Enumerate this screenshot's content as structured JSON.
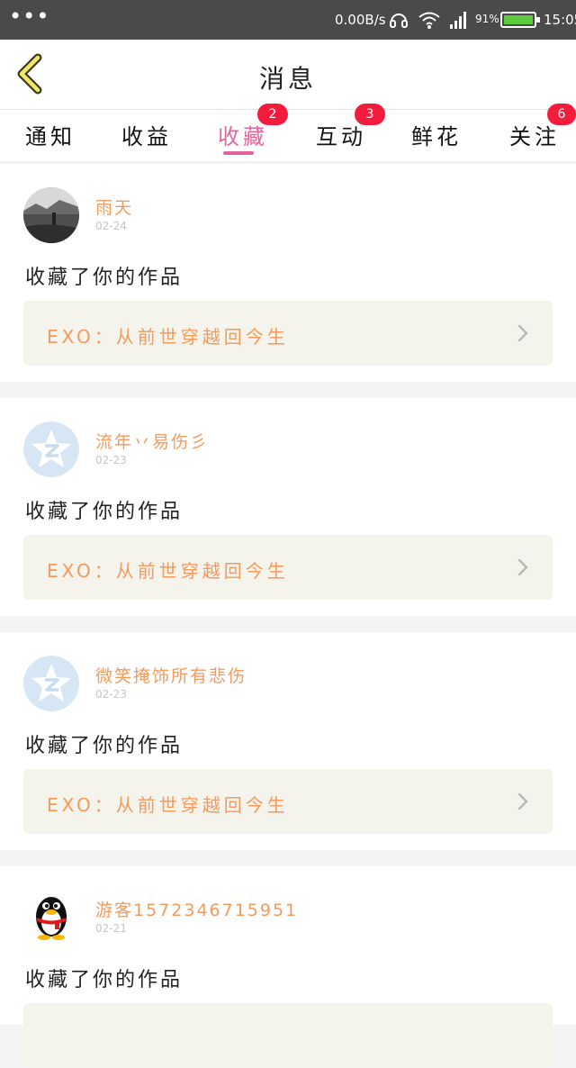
{
  "status_bar": {
    "dots": "•••",
    "network_speed": "0.00B/s",
    "battery_percent": "91%",
    "time": "15:05",
    "icons": [
      "headphones-icon",
      "wifi-icon",
      "signal-icon",
      "battery-icon"
    ]
  },
  "nav": {
    "title": "消息",
    "back_icon": "chevron-left-icon"
  },
  "tabs": [
    {
      "label": "通知"
    },
    {
      "label": "收益"
    },
    {
      "label": "收藏",
      "badge": "2",
      "active": true
    },
    {
      "label": "互动",
      "badge": "3"
    },
    {
      "label": "鲜花"
    },
    {
      "label": "关注",
      "badge": "6"
    }
  ],
  "colors": {
    "accent": "#e0679e",
    "orange_text": "#f39a5c",
    "badge": "#f41c3d"
  },
  "messages": [
    {
      "name": "雨天",
      "date": "02-24",
      "action": "收藏了你的作品",
      "work": "EXO：从前世穿越回今生",
      "avatar": "photo-avatar"
    },
    {
      "name": "流年丷易伤彡",
      "date": "02-23",
      "action": "收藏了你的作品",
      "work": "EXO：从前世穿越回今生",
      "avatar": "qzone-star-avatar"
    },
    {
      "name": "微笑掩饰所有悲伤",
      "date": "02-23",
      "action": "收藏了你的作品",
      "work": "EXO：从前世穿越回今生",
      "avatar": "qzone-star-avatar"
    },
    {
      "name": "游客1572346715951",
      "date": "02-21",
      "action": "收藏了你的作品",
      "work": "",
      "avatar": "penguin-avatar"
    }
  ]
}
